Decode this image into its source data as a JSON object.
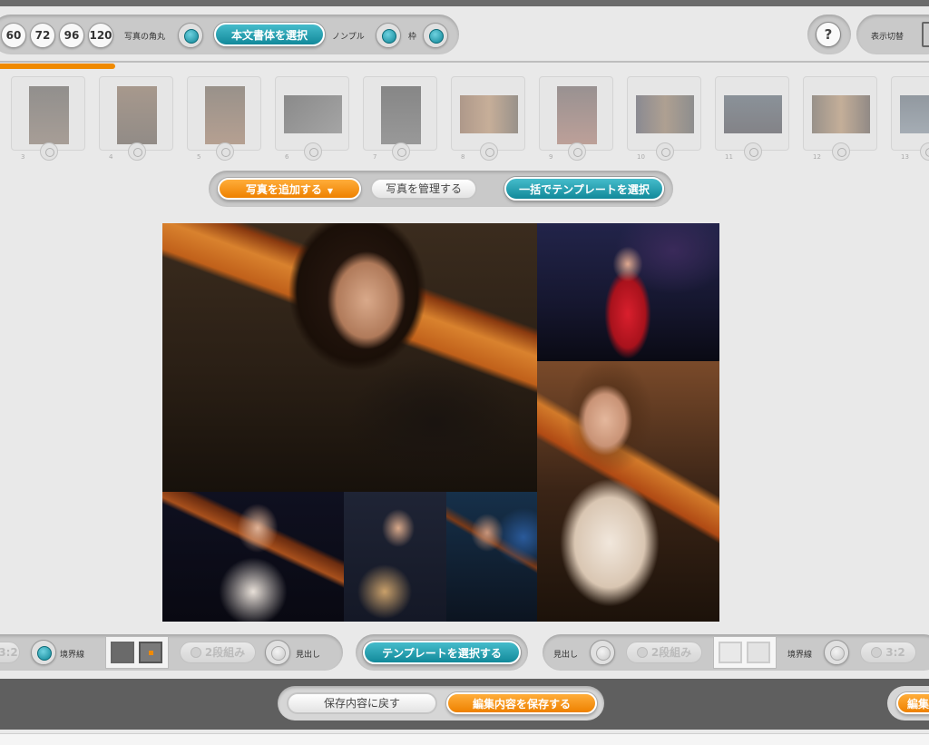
{
  "toolbar": {
    "sizes": [
      "60",
      "72",
      "96",
      "120"
    ],
    "corner_label": "写真の角丸",
    "font_button": "本文書体を選択",
    "nonpuru_label": "ノンプル",
    "waku_label": "枠",
    "help_label": "?",
    "view_switch_label": "表示切替"
  },
  "thumbnails": {
    "numbers": [
      "3",
      "4",
      "5",
      "6",
      "7",
      "8",
      "9",
      "10",
      "11",
      "12",
      "13"
    ]
  },
  "photo_actions": {
    "add_label": "写真を追加する",
    "add_caret": "▼",
    "manage_label": "写真を管理する",
    "template_all_label": "一括でテンプレートを選択"
  },
  "bottom_toolbar": {
    "left_ratio": "3:2",
    "left_border_label": "境界線",
    "left_columns": "2段組み",
    "left_heading_label": "見出し",
    "template_label": "テンプレートを選択する",
    "right_heading_label": "見出し",
    "right_columns": "2段組み",
    "right_border_label": "境界線",
    "right_ratio": "3:2"
  },
  "footer": {
    "revert_label": "保存内容に戻す",
    "save_label": "編集内容を保存する",
    "right_edge_label": "編集"
  },
  "colors": {
    "accent_orange": "#f08a00",
    "accent_teal": "#1696a8"
  }
}
